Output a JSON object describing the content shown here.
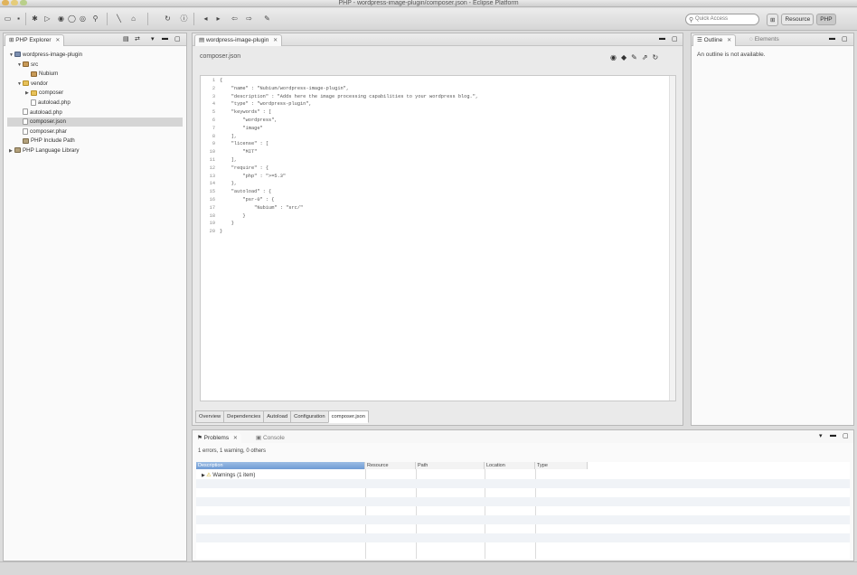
{
  "window": {
    "title": "PHP - wordpress-image-plugin/composer.json - Eclipse Platform"
  },
  "toolbar": {
    "search_placeholder": "Quick Access",
    "perspectives": [
      "Resource",
      "PHP"
    ]
  },
  "explorer": {
    "tab_label": "PHP Explorer",
    "tree": [
      {
        "label": "wordpress-image-plugin",
        "depth": 0,
        "icon": "project-icon",
        "twisty": "▼"
      },
      {
        "label": "src",
        "depth": 1,
        "icon": "package-icon",
        "twisty": "▼"
      },
      {
        "label": "Nubium",
        "depth": 2,
        "icon": "package-icon",
        "twisty": ""
      },
      {
        "label": "vendor",
        "depth": 1,
        "icon": "folder-icon",
        "twisty": "▼"
      },
      {
        "label": "composer",
        "depth": 2,
        "icon": "folder-icon",
        "twisty": "▶"
      },
      {
        "label": "autoload.php",
        "depth": 2,
        "icon": "file-icon",
        "twisty": ""
      },
      {
        "label": "autoload.php",
        "depth": 1,
        "icon": "file-icon",
        "twisty": ""
      },
      {
        "label": "composer.json",
        "depth": 1,
        "icon": "file-icon",
        "twisty": "",
        "selected": true
      },
      {
        "label": "composer.phar",
        "depth": 1,
        "icon": "file-icon",
        "twisty": ""
      },
      {
        "label": "PHP Include Path",
        "depth": 1,
        "icon": "library-icon",
        "twisty": ""
      },
      {
        "label": "PHP Language Library",
        "depth": 0,
        "icon": "library-icon",
        "twisty": "▶"
      }
    ]
  },
  "editor": {
    "tab_label": "wordpress-image-plugin",
    "header_title": "composer.json",
    "code": [
      {
        "n": "1",
        "text": "{"
      },
      {
        "n": "2",
        "text": "    \"name\" : \"Nubium/wordpress-image-plugin\","
      },
      {
        "n": "3",
        "text": "    \"description\" : \"Adds here the image processing capabilities to your wordpress blog.\","
      },
      {
        "n": "4",
        "text": "    \"type\" : \"wordpress-plugin\","
      },
      {
        "n": "5",
        "text": "    \"keywords\" : ["
      },
      {
        "n": "6",
        "text": "        \"wordpress\","
      },
      {
        "n": "7",
        "text": "        \"image\""
      },
      {
        "n": "8",
        "text": "    ],"
      },
      {
        "n": "9",
        "text": "    \"license\" : ["
      },
      {
        "n": "10",
        "text": "        \"MIT\""
      },
      {
        "n": "11",
        "text": "    ],"
      },
      {
        "n": "12",
        "text": "    \"require\" : {"
      },
      {
        "n": "13",
        "text": "        \"php\" : \">=5.3\""
      },
      {
        "n": "14",
        "text": "    },"
      },
      {
        "n": "15",
        "text": "    \"autoload\" : {"
      },
      {
        "n": "16",
        "text": "        \"psr-0\" : {"
      },
      {
        "n": "17",
        "text": "            \"Nubium\" : \"src/\""
      },
      {
        "n": "18",
        "text": "        }"
      },
      {
        "n": "19",
        "text": "    }"
      },
      {
        "n": "20",
        "text": "}"
      }
    ],
    "bottom_tabs": [
      "Overview",
      "Dependencies",
      "Autoload",
      "Configuration",
      "composer.json"
    ],
    "active_bottom_tab": 4
  },
  "outline": {
    "tabs": [
      "Outline",
      "Elements"
    ],
    "message": "An outline is not available."
  },
  "problems": {
    "tabs": [
      "Problems",
      "Console"
    ],
    "summary": "1 errors, 1 warning, 0 others",
    "columns": [
      "Description",
      "Resource",
      "Path",
      "Location",
      "Type"
    ],
    "rows": [
      {
        "label": "Warnings (1 item)"
      }
    ]
  }
}
